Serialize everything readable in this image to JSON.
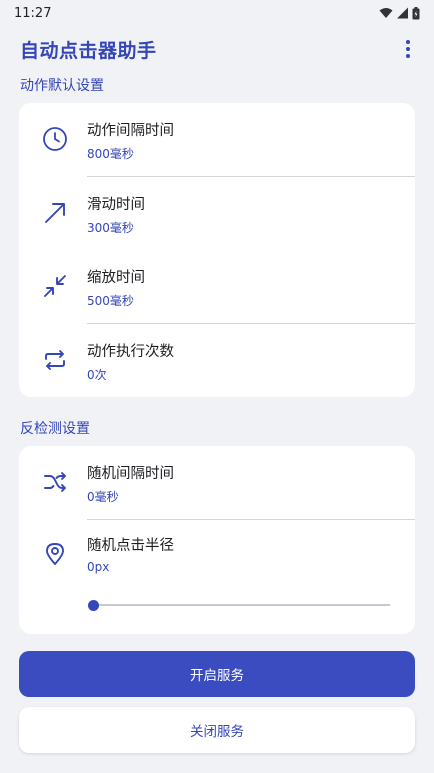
{
  "status_bar": {
    "time": "11:27"
  },
  "app_bar": {
    "title": "自动点击器助手",
    "menu_icon": "more-vert-icon"
  },
  "colors": {
    "accent": "#3546b8",
    "background": "#f1f2f6",
    "card": "#ffffff",
    "primary_button": "#3a4cc0"
  },
  "action_defaults": {
    "header": "动作默认设置",
    "items": [
      {
        "icon": "clock-icon",
        "title": "动作间隔时间",
        "value": "800毫秒"
      },
      {
        "icon": "arrow-diagonal-icon",
        "title": "滑动时间",
        "value": "300毫秒"
      },
      {
        "icon": "pinch-icon",
        "title": "缩放时间",
        "value": "500毫秒"
      },
      {
        "icon": "repeat-icon",
        "title": "动作执行次数",
        "value": "0次"
      }
    ]
  },
  "anti_detect": {
    "header": "反检测设置",
    "items": [
      {
        "icon": "shuffle-icon",
        "title": "随机间隔时间",
        "value": "0毫秒"
      },
      {
        "icon": "location-pin-icon",
        "title": "随机点击半径",
        "value": "0px"
      }
    ],
    "radius_slider_fraction": 0
  },
  "buttons": {
    "start": "开启服务",
    "stop": "关闭服务"
  }
}
